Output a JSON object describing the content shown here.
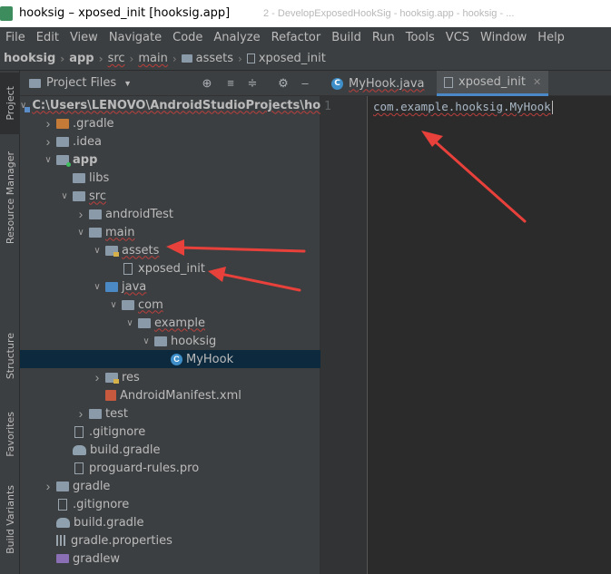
{
  "window": {
    "title": "hooksig – xposed_init [hooksig.app]",
    "background_title_text": "2 - DevelopExposedHookSig - hooksig.app - hooksig - ..."
  },
  "menu": [
    "File",
    "Edit",
    "View",
    "Navigate",
    "Code",
    "Analyze",
    "Refactor",
    "Build",
    "Run",
    "Tools",
    "VCS",
    "Window",
    "Help"
  ],
  "breadcrumb": [
    "hooksig",
    "app",
    "src",
    "main",
    "assets",
    "xposed_init"
  ],
  "left_stripe": {
    "tabs": [
      "Project",
      "Resource Manager",
      "Structure",
      "Favorites",
      "Build Variants"
    ]
  },
  "project_panel": {
    "title": "Project Files",
    "icons": [
      "target-icon",
      "collapse-all-icon",
      "expand-all-icon",
      "gear-icon",
      "minimize-icon"
    ]
  },
  "tree": [
    {
      "label": "C:\\Users\\LENOVO\\AndroidStudioProjects\\hook",
      "depth": 0,
      "arrow": "open",
      "icon": "project",
      "bold": true,
      "squiggle": true
    },
    {
      "label": ".gradle",
      "depth": 1,
      "arrow": "closed",
      "icon": "folder-orange"
    },
    {
      "label": ".idea",
      "depth": 1,
      "arrow": "closed",
      "icon": "folder"
    },
    {
      "label": "app",
      "depth": 1,
      "arrow": "open",
      "icon": "module",
      "bold": true
    },
    {
      "label": "libs",
      "depth": 2,
      "arrow": "none",
      "icon": "folder"
    },
    {
      "label": "src",
      "depth": 2,
      "arrow": "open",
      "icon": "folder",
      "squiggle": true
    },
    {
      "label": "androidTest",
      "depth": 3,
      "arrow": "closed",
      "icon": "folder"
    },
    {
      "label": "main",
      "depth": 3,
      "arrow": "open",
      "icon": "folder",
      "squiggle": true
    },
    {
      "label": "assets",
      "depth": 4,
      "arrow": "open",
      "icon": "folder-res",
      "squiggle": true
    },
    {
      "label": "xposed_init",
      "depth": 5,
      "arrow": "none",
      "icon": "file"
    },
    {
      "label": "java",
      "depth": 4,
      "arrow": "open",
      "icon": "folder-blue",
      "squiggle": true
    },
    {
      "label": "com",
      "depth": 5,
      "arrow": "open",
      "icon": "folder",
      "squiggle": true
    },
    {
      "label": "example",
      "depth": 6,
      "arrow": "open",
      "icon": "folder",
      "squiggle": true
    },
    {
      "label": "hooksig",
      "depth": 7,
      "arrow": "open",
      "icon": "folder"
    },
    {
      "label": "MyHook",
      "depth": 8,
      "arrow": "none",
      "icon": "class",
      "selected": true
    },
    {
      "label": "res",
      "depth": 4,
      "arrow": "closed",
      "icon": "folder-res"
    },
    {
      "label": "AndroidManifest.xml",
      "depth": 4,
      "arrow": "none",
      "icon": "xml"
    },
    {
      "label": "test",
      "depth": 3,
      "arrow": "closed",
      "icon": "folder"
    },
    {
      "label": ".gitignore",
      "depth": 2,
      "arrow": "none",
      "icon": "gitfile"
    },
    {
      "label": "build.gradle",
      "depth": 2,
      "arrow": "none",
      "icon": "gradle"
    },
    {
      "label": "proguard-rules.pro",
      "depth": 2,
      "arrow": "none",
      "icon": "gitfile"
    },
    {
      "label": "gradle",
      "depth": 1,
      "arrow": "closed",
      "icon": "folder"
    },
    {
      "label": ".gitignore",
      "depth": 1,
      "arrow": "none",
      "icon": "gitfile"
    },
    {
      "label": "build.gradle",
      "depth": 1,
      "arrow": "none",
      "icon": "gradle"
    },
    {
      "label": "gradle.properties",
      "depth": 1,
      "arrow": "none",
      "icon": "props"
    },
    {
      "label": "gradlew",
      "depth": 1,
      "arrow": "none",
      "icon": "cmd"
    }
  ],
  "editor": {
    "tabs": [
      {
        "label": "MyHook.java",
        "icon": "class",
        "active": false
      },
      {
        "label": "xposed_init",
        "icon": "file",
        "active": true
      }
    ],
    "line_number": "1",
    "code": "com.example.hooksig.MyHook"
  },
  "colors": {
    "annotation_arrow": "#e8403a",
    "selection": "#0d293e",
    "accent_tab": "#4a88c7"
  }
}
